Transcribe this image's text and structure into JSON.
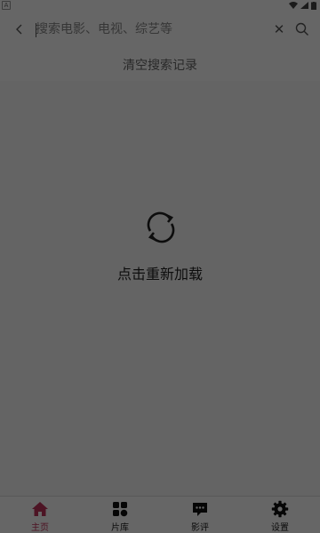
{
  "search": {
    "placeholder": "搜索电影、电视、综艺等",
    "value": ""
  },
  "history": {
    "clear_label": "清空搜索记录"
  },
  "reload": {
    "label": "点击重新加载"
  },
  "nav": {
    "items": [
      {
        "label": "主页",
        "icon": "home-icon",
        "active": true
      },
      {
        "label": "片库",
        "icon": "library-icon",
        "active": false
      },
      {
        "label": "影评",
        "icon": "comment-icon",
        "active": false
      },
      {
        "label": "设置",
        "icon": "settings-icon",
        "active": false
      }
    ]
  },
  "colors": {
    "accent": "#c0325a",
    "overlay": "rgba(0,0,0,0.6)"
  }
}
